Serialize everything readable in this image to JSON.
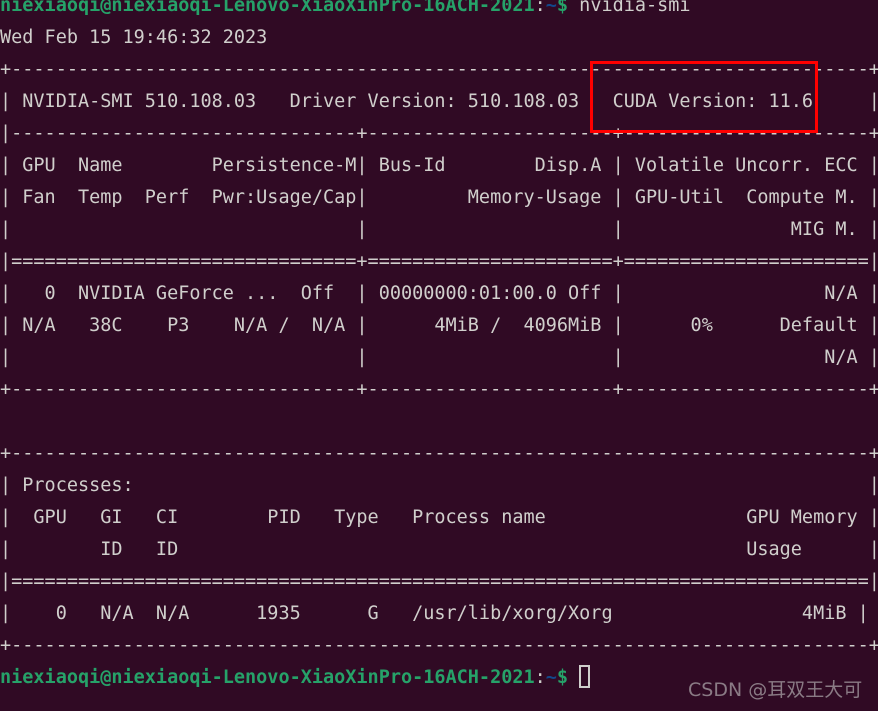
{
  "terminal": {
    "background_color": "#300a24",
    "foreground_color": "#d0cfcc",
    "prompt_user_color": "#26a269",
    "prompt_path_color": "#12488b",
    "highlight_color": "#ff0000",
    "command": "nvidia-smi",
    "timestamp": "Wed Feb 15 19:46:32 2023",
    "prompt": {
      "user_host": "niexiaoqi@niexiaoqi-Lenovo-XiaoXinPro-16ACH-2021",
      "separator": ":",
      "path": "~",
      "sigil": "$"
    }
  },
  "lines": [
    {
      "type": "prompt",
      "user_host": "niexiaoqi@niexiaoqi-Lenovo-XiaoXinPro-16ACH-2021",
      "sep": ":",
      "path": "~",
      "sigil": "$",
      "command": " nvidia-smi"
    },
    {
      "type": "out",
      "text": "Wed Feb 15 19:46:32 2023"
    },
    {
      "type": "out",
      "text": "+-----------------------------------------------------------------------------+"
    },
    {
      "type": "out",
      "text": "| NVIDIA-SMI 510.108.03   Driver Version: 510.108.03   CUDA Version: 11.6     |"
    },
    {
      "type": "out",
      "text": "|-------------------------------+----------------------+----------------------+"
    },
    {
      "type": "out",
      "text": "| GPU  Name        Persistence-M| Bus-Id        Disp.A | Volatile Uncorr. ECC |"
    },
    {
      "type": "out",
      "text": "| Fan  Temp  Perf  Pwr:Usage/Cap|         Memory-Usage | GPU-Util  Compute M. |"
    },
    {
      "type": "out",
      "text": "|                               |                      |               MIG M. |"
    },
    {
      "type": "out",
      "text": "|===============================+======================+======================|"
    },
    {
      "type": "out",
      "text": "|   0  NVIDIA GeForce ...  Off  | 00000000:01:00.0 Off |                  N/A |"
    },
    {
      "type": "out",
      "text": "| N/A   38C    P3    N/A /  N/A |      4MiB /  4096MiB |      0%      Default |"
    },
    {
      "type": "out",
      "text": "|                               |                      |                  N/A |"
    },
    {
      "type": "out",
      "text": "+-------------------------------+----------------------+----------------------+"
    },
    {
      "type": "out",
      "text": ""
    },
    {
      "type": "out",
      "text": "+-----------------------------------------------------------------------------+"
    },
    {
      "type": "out",
      "text": "| Processes:                                                                  |"
    },
    {
      "type": "out",
      "text": "|  GPU   GI   CI        PID   Type   Process name                  GPU Memory |"
    },
    {
      "type": "out",
      "text": "|        ID   ID                                                   Usage      |"
    },
    {
      "type": "out",
      "text": "|=============================================================================|"
    },
    {
      "type": "out",
      "text": "|    0   N/A  N/A      1935      G   /usr/lib/xorg/Xorg                 4MiB |"
    },
    {
      "type": "out",
      "text": "+-----------------------------------------------------------------------------+"
    },
    {
      "type": "prompt",
      "user_host": "niexiaoqi@niexiaoqi-Lenovo-XiaoXinPro-16ACH-2021",
      "sep": ":",
      "path": "~",
      "sigil": "$",
      "command": "",
      "cursor": true
    }
  ],
  "nvidia_smi": {
    "smi_version": "510.108.03",
    "driver_version_label": "Driver Version:",
    "driver_version": "510.108.03",
    "cuda_version_label": "CUDA Version:",
    "cuda_version": "11.6",
    "gpu_table": {
      "headers_row1": [
        "GPU",
        "Name",
        "Persistence-M",
        "Bus-Id",
        "Disp.A",
        "Volatile Uncorr. ECC"
      ],
      "headers_row2": [
        "Fan",
        "Temp",
        "Perf",
        "Pwr:Usage/Cap",
        "Memory-Usage",
        "GPU-Util",
        "Compute M."
      ],
      "headers_row3": [
        "MIG M."
      ],
      "rows": [
        {
          "gpu": "0",
          "name": "NVIDIA GeForce ...",
          "persistence_m": "Off",
          "bus_id": "00000000:01:00.0",
          "disp_a": "Off",
          "uncorr_ecc": "N/A",
          "fan": "N/A",
          "temp": "38C",
          "perf": "P3",
          "pwr_usage_cap": "N/A /  N/A",
          "memory_usage": "4MiB /  4096MiB",
          "gpu_util": "0%",
          "compute_m": "Default",
          "mig_m": "N/A"
        }
      ]
    },
    "processes": {
      "title": "Processes:",
      "headers_row1": [
        "GPU",
        "GI",
        "CI",
        "PID",
        "Type",
        "Process name",
        "GPU Memory"
      ],
      "headers_row2": [
        "ID",
        "ID",
        "Usage"
      ],
      "rows": [
        {
          "gpu": "0",
          "gi_id": "N/A",
          "ci_id": "N/A",
          "pid": "1935",
          "type": "G",
          "process_name": "/usr/lib/xorg/Xorg",
          "gpu_memory_usage": "4MiB"
        }
      ]
    }
  },
  "annotation": {
    "highlight_label": "CUDA Version: 11.6",
    "color": "#ff0000"
  },
  "watermark": {
    "text": "CSDN @耳双王大可"
  }
}
